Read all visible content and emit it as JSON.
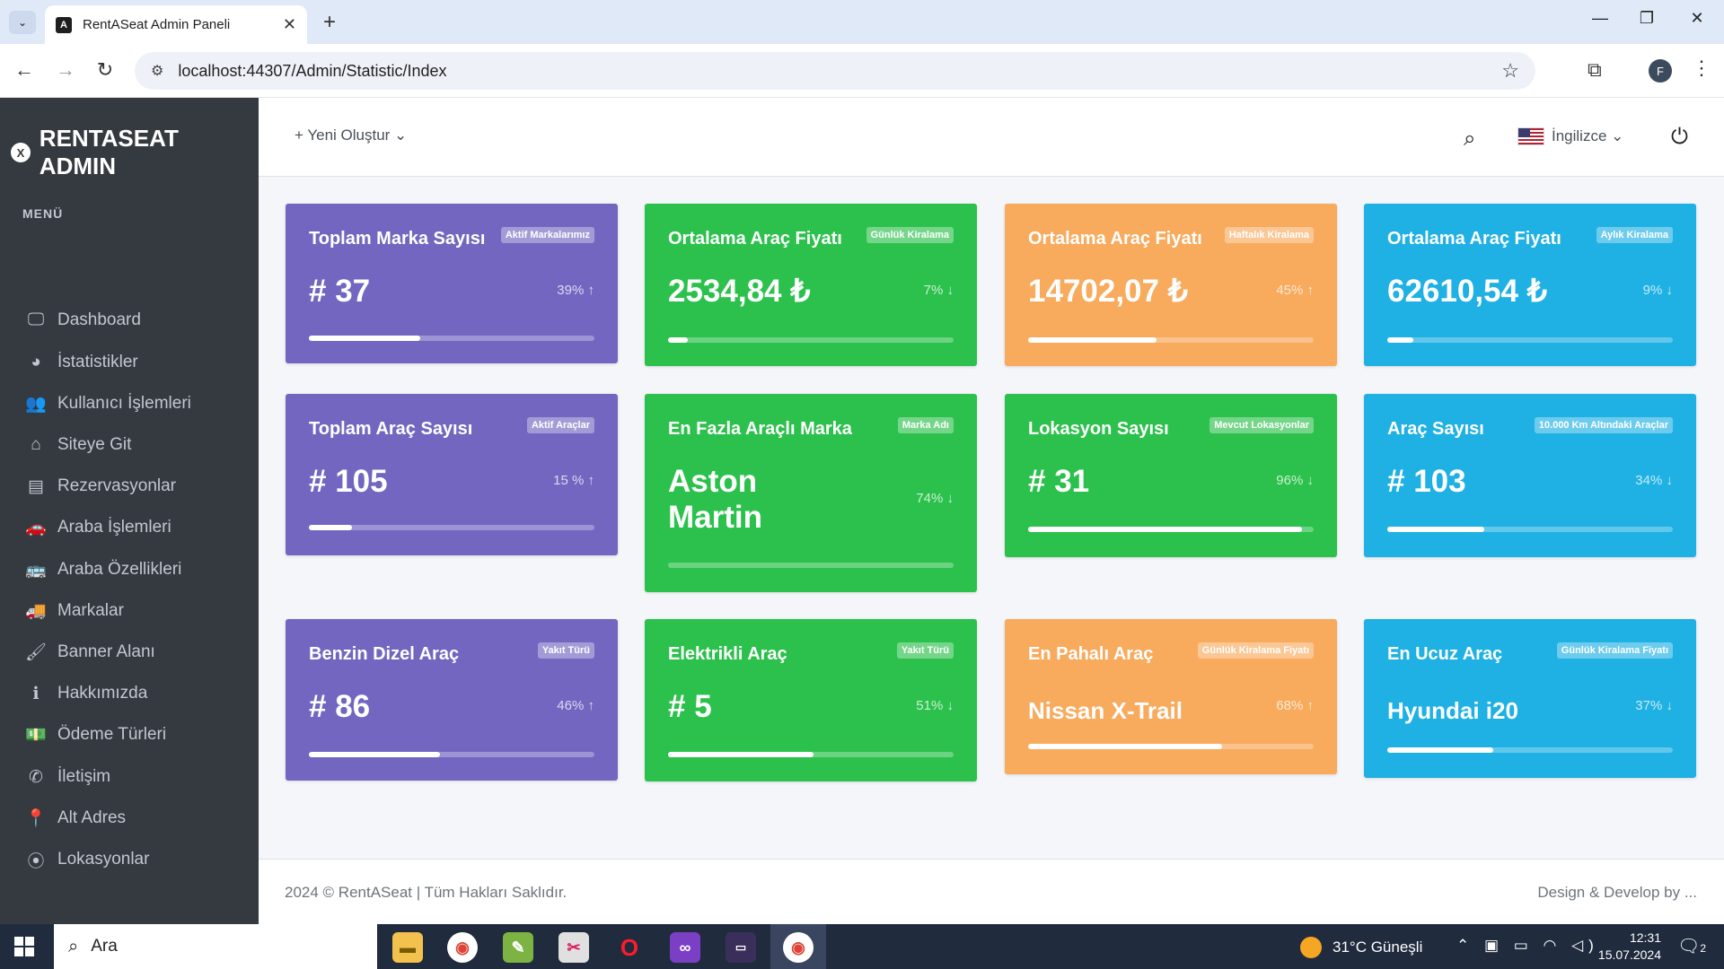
{
  "browser": {
    "tab_title": "RentASeat Admin Paneli",
    "tab_close": "✕",
    "new_tab": "+",
    "url": "localhost:44307/Admin/Statistic/Index",
    "profile_initial": "F",
    "window_controls": [
      "—",
      "❐",
      "✕"
    ]
  },
  "sidebar": {
    "brand": "RENTASEAT ADMIN",
    "menu_header": "MENÜ",
    "items": [
      {
        "label": "Dashboard",
        "icon": "monitor-icon",
        "glyph": "🖵"
      },
      {
        "label": "İstatistikler",
        "icon": "chart-pie-icon",
        "glyph": "◕"
      },
      {
        "label": "Kullanıcı İşlemleri",
        "icon": "users-cog-icon",
        "glyph": "👥"
      },
      {
        "label": "Siteye Git",
        "icon": "home-icon",
        "glyph": "⌂"
      },
      {
        "label": "Rezervasyonlar",
        "icon": "keyboard-icon",
        "glyph": "▤"
      },
      {
        "label": "Araba İşlemleri",
        "icon": "car-icon",
        "glyph": "🚗"
      },
      {
        "label": "Araba Özellikleri",
        "icon": "bus-icon",
        "glyph": "🚌"
      },
      {
        "label": "Markalar",
        "icon": "truck-icon",
        "glyph": "🚚"
      },
      {
        "label": "Banner Alanı",
        "icon": "paint-brush-icon",
        "glyph": "🖌"
      },
      {
        "label": "Hakkımızda",
        "icon": "info-icon",
        "glyph": "ℹ"
      },
      {
        "label": "Ödeme Türleri",
        "icon": "money-bill-icon",
        "glyph": "💵"
      },
      {
        "label": "İletişim",
        "icon": "phone-icon",
        "glyph": "✆"
      },
      {
        "label": "Alt Adres",
        "icon": "map-marker-icon",
        "glyph": "📍"
      },
      {
        "label": "Lokasyonlar",
        "icon": "location-icon",
        "glyph": "⦿"
      }
    ]
  },
  "topnav": {
    "new_button": "+ Yeni Oluştur ⌄",
    "language": "İngilizce ⌄"
  },
  "cards": [
    {
      "title": "Toplam Marka Sayısı",
      "badge": "Aktif Markalarımız",
      "value": "# 37",
      "pct": "39% ↑",
      "progress": 0.39,
      "color": "purple"
    },
    {
      "title": "Ortalama Araç Fiyatı",
      "badge": "Günlük Kiralama",
      "value": "2534,84 ₺",
      "pct": "7% ↓",
      "progress": 0.07,
      "color": "green"
    },
    {
      "title": "Ortalama Araç Fiyatı",
      "badge": "Haftalık Kiralama",
      "value": "14702,07 ₺",
      "pct": "45% ↑",
      "progress": 0.45,
      "color": "orange"
    },
    {
      "title": "Ortalama Araç Fiyatı",
      "badge": "Aylık Kiralama",
      "value": "62610,54 ₺",
      "pct": "9% ↓",
      "progress": 0.09,
      "color": "blue"
    },
    {
      "title": "Toplam Araç Sayısı",
      "badge": "Aktif Araçlar",
      "value": "# 105",
      "pct": "15 % ↑",
      "progress": 0.15,
      "color": "purple"
    },
    {
      "title": "En Fazla Araçlı Marka",
      "badge": "Marka Adı",
      "value": "Aston Martin",
      "pct": "74% ↓",
      "progress": 0.0,
      "color": "green"
    },
    {
      "title": "Lokasyon Sayısı",
      "badge": "Mevcut Lokasyonlar",
      "value": "# 31",
      "pct": "96% ↓",
      "progress": 0.96,
      "color": "green"
    },
    {
      "title": "Araç Sayısı",
      "badge": "10.000 Km Altındaki Araçlar",
      "value": "# 103",
      "pct": "34% ↓",
      "progress": 0.34,
      "color": "blue"
    },
    {
      "title": "Benzin Dizel Araç",
      "badge": "Yakıt Türü",
      "value": "# 86",
      "pct": "46% ↑",
      "progress": 0.46,
      "color": "purple"
    },
    {
      "title": "Elektrikli Araç",
      "badge": "Yakıt Türü",
      "value": "# 5",
      "pct": "51% ↓",
      "progress": 0.51,
      "color": "green"
    },
    {
      "title": "En Pahalı Araç",
      "badge": "Günlük Kiralama Fiyatı",
      "value": "Nissan X-Trail",
      "pct": "68% ↑",
      "progress": 0.68,
      "color": "orange"
    },
    {
      "title": "En Ucuz Araç",
      "badge": "Günlük Kiralama Fiyatı",
      "value": "Hyundai i20",
      "pct": "37% ↓",
      "progress": 0.37,
      "color": "blue"
    }
  ],
  "footer": {
    "left": "2024 © RentASeat | Tüm Hakları Saklıdır.",
    "right": "Design & Develop by ..."
  },
  "taskbar": {
    "search_placeholder": "Ara",
    "weather": "31°C  Güneşli",
    "time": "12:31",
    "date": "15.07.2024",
    "notifications": "2",
    "tray": "⌃ ▣ ▭ ◠ ◁)"
  }
}
